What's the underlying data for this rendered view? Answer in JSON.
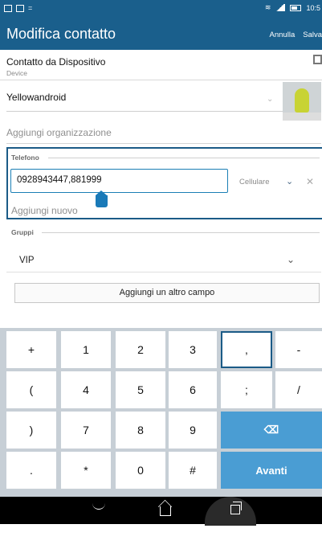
{
  "status_bar": {
    "time": "10:5"
  },
  "action_bar": {
    "title": "Modifica contatto",
    "cancel_label": "Annulla",
    "save_label": "Salva"
  },
  "account": {
    "name": "Contatto da Dispositivo",
    "type": "Device"
  },
  "name_field": {
    "value": "Yellowandroid"
  },
  "organization": {
    "placeholder": "Aggiungi organizzazione"
  },
  "phone": {
    "section_label": "Telefono",
    "value": "0928943447,881999",
    "type": "Cellulare",
    "add_new": "Aggiungi nuovo"
  },
  "groups": {
    "section_label": "Gruppi",
    "selected": "VIP"
  },
  "add_field_button": "Aggiungi un altro campo",
  "keyboard": {
    "rows": [
      [
        "+",
        "1",
        "2",
        "3",
        ",",
        "-"
      ],
      [
        "(",
        "4",
        "5",
        "6",
        ";",
        "/"
      ],
      [
        ")",
        "7",
        "8",
        "9",
        "⌫"
      ],
      [
        ".",
        "*",
        "0",
        "#",
        "Avanti"
      ]
    ],
    "selected_key": ","
  },
  "colors": {
    "accent": "#1a5f8c",
    "keyboard_bg": "#c7cfd6",
    "action_key": "#4a9dd3"
  },
  "icons": [
    "sim-icon",
    "wifi-icon",
    "signal-icon",
    "battery-icon",
    "chevron-down-icon",
    "close-icon",
    "backspace-icon",
    "back-icon",
    "home-icon",
    "recents-icon"
  ]
}
